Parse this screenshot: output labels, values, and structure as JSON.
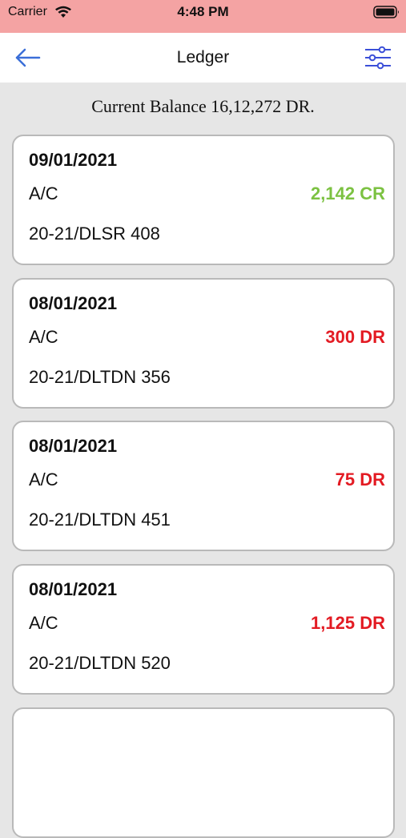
{
  "status_bar": {
    "carrier": "Carrier",
    "time": "4:48 PM",
    "wifi_icon": "wifi-icon",
    "battery_icon": "battery-icon"
  },
  "nav": {
    "title": "Ledger",
    "back_icon": "back-arrow-icon",
    "filter_icon": "filter-sliders-icon"
  },
  "balance": {
    "text": "Current Balance 16,12,272 DR."
  },
  "colors": {
    "credit": "#7cc242",
    "debit": "#e31b23",
    "accent": "#3b6fd8"
  },
  "entries": [
    {
      "date": "09/01/2021",
      "account": "A/C",
      "amount": "2,142 CR",
      "type": "credit",
      "ref": "20-21/DLSR 408"
    },
    {
      "date": "08/01/2021",
      "account": "A/C",
      "amount": "300 DR",
      "type": "debit",
      "ref": "20-21/DLTDN 356"
    },
    {
      "date": "08/01/2021",
      "account": "A/C",
      "amount": "75 DR",
      "type": "debit",
      "ref": "20-21/DLTDN 451"
    },
    {
      "date": "08/01/2021",
      "account": "A/C",
      "amount": "1,125 DR",
      "type": "debit",
      "ref": "20-21/DLTDN 520"
    },
    {
      "date": "",
      "account": "",
      "amount": "",
      "type": "debit",
      "ref": ""
    }
  ]
}
